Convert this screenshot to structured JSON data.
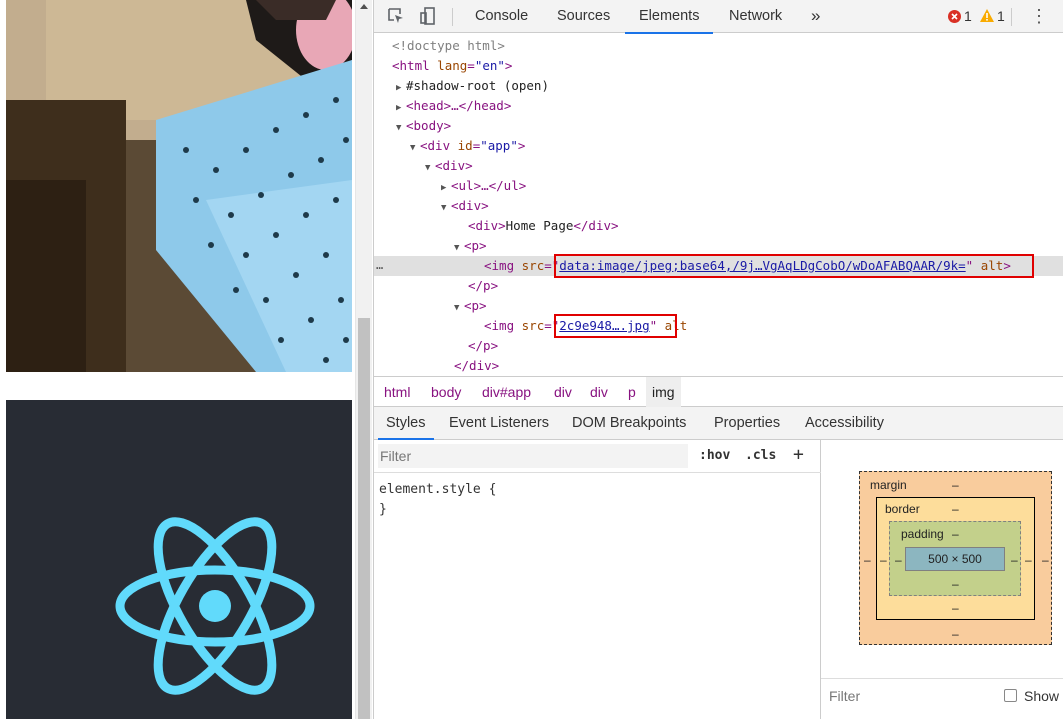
{
  "devtools": {
    "tabs": [
      {
        "label": "Console"
      },
      {
        "label": "Sources"
      },
      {
        "label": "Elements",
        "active": true
      },
      {
        "label": "Network"
      }
    ],
    "more_tabs": "»",
    "error_count": "1",
    "warning_count": "1",
    "kebab": "⋮",
    "icons": [
      "inspect-element-icon",
      "device-toolbar-icon",
      "error-icon",
      "warning-icon",
      "more-options-icon"
    ]
  },
  "dom_tree": {
    "doctype": "<!doctype html>",
    "html_open": "<html",
    "html_lang_attr": "lang",
    "html_lang_val": "\"en\"",
    "shadow_root": "#shadow-root (open)",
    "head": "<head>…</head>",
    "body": "<body>",
    "div_app_tag": "<div",
    "div_app_attr": "id",
    "div_app_val": "\"app\"",
    "div1": "<div>",
    "ul": "<ul>…</ul>",
    "div2": "<div>",
    "home_div_open": "<div>",
    "home_text": "Home Page",
    "home_div_close": "</div>",
    "p1": "<p>",
    "img1_tag": "<img",
    "img1_attr": "src",
    "img1_src": "data:image/jpeg;base64,/9j…VgAqLDgCobO/wDoAFABQAAR/9k=",
    "img1_alt": "alt",
    "p1_close": "</p>",
    "p2": "<p>",
    "img2_tag": "<img",
    "img2_attr": "src",
    "img2_src": "2c9e948….jpg",
    "img2_alt": "alt",
    "p2_close": "</p>",
    "div_close": "</div>",
    "ellipsis": "…"
  },
  "breadcrumbs": [
    "html",
    "body",
    "div#app",
    "div",
    "div",
    "p",
    "img"
  ],
  "sub_tabs": [
    {
      "label": "Styles",
      "active": true
    },
    {
      "label": "Event Listeners"
    },
    {
      "label": "DOM Breakpoints"
    },
    {
      "label": "Properties"
    },
    {
      "label": "Accessibility"
    }
  ],
  "styles": {
    "filter_placeholder": "Filter",
    "hov": ":hov",
    "cls": ".cls",
    "plus": "+",
    "element_style": "element.style {",
    "close_brace": "}"
  },
  "box_model": {
    "margin_label": "margin",
    "border_label": "border",
    "padding_label": "padding",
    "content": "500 × 500",
    "dash": "–",
    "filter_placeholder": "Filter",
    "show_label": "Show"
  },
  "colors": {
    "accent": "#1a73e8",
    "highlight_box": "#e00000",
    "react_blue": "#61dafb",
    "react_bg": "#282c34"
  }
}
